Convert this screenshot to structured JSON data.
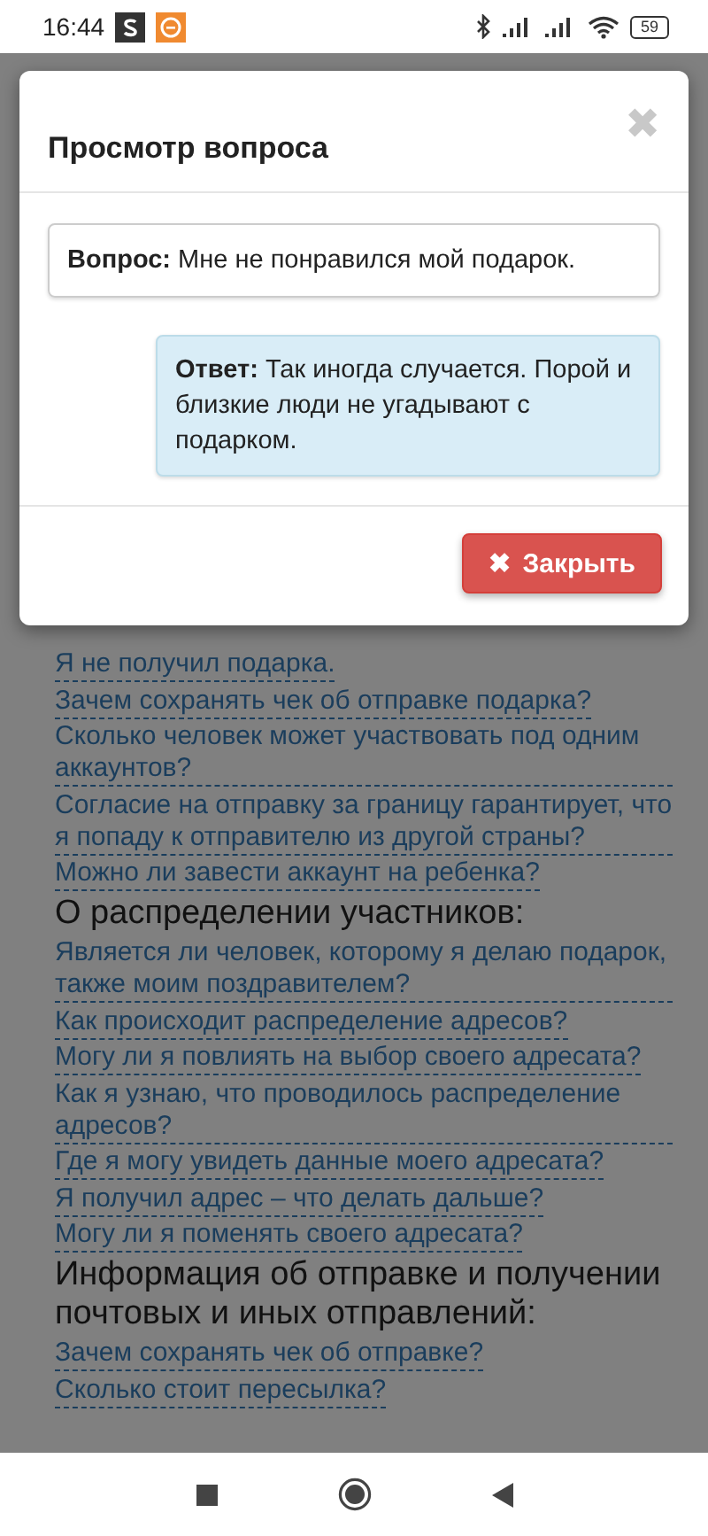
{
  "status_bar": {
    "time": "16:44",
    "battery": "59"
  },
  "modal": {
    "title": "Просмотр вопроса",
    "close_glyph": "✖",
    "question": {
      "label": "Вопрос:",
      "text": "Мне не понравился мой подарок."
    },
    "answer": {
      "label": "Ответ:",
      "text": "Так иногда случается. Порой и близкие люди не угадывают с подарком."
    },
    "close_button": {
      "icon": "✖",
      "label": "Закрыть"
    }
  },
  "faq": [
    {
      "items": [
        "Я не получил подарка.",
        "Зачем сохранять чек об отправке подарка?",
        "Сколько человек может участвовать под одним аккаунтов?",
        "Согласие на отправку за границу гарантирует, что я попаду к отправителю из другой страны?",
        "Можно ли завести аккаунт на ребенка?"
      ]
    },
    {
      "heading": "О распределении участников:",
      "items": [
        "Является ли человек, которому я делаю подарок, также моим поздравителем?",
        "Как происходит распределение адресов?",
        "Могу ли я повлиять на выбор своего адресата?",
        "Как я узнаю, что проводилось распределение адресов?",
        "Где я могу увидеть данные моего адресата?",
        "Я получил адрес – что делать дальше?",
        "Могу ли я поменять своего адресата?"
      ]
    },
    {
      "heading": "Информация об отправке и получении почтовых и иных отправлений:",
      "items": [
        "Зачем сохранять чек об отправке?",
        "Сколько стоит пересылка?"
      ]
    }
  ]
}
